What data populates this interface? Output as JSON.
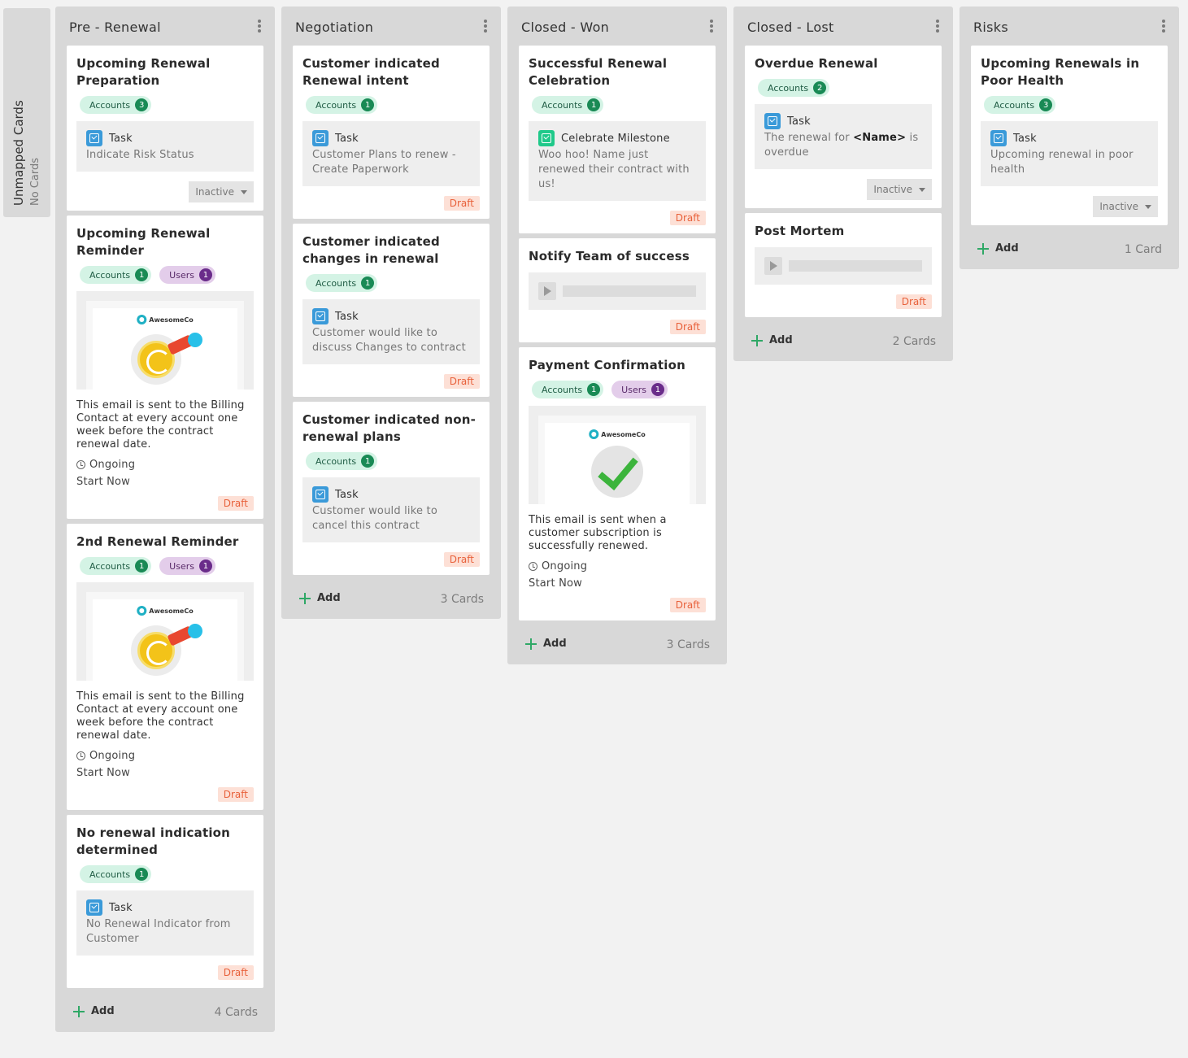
{
  "unmapped": {
    "title": "Unmapped Cards",
    "subtitle": "No Cards"
  },
  "columns": [
    {
      "title": "Pre - Renewal",
      "add_label": "Add",
      "count": "4 Cards",
      "cards": [
        {
          "title": "Upcoming Renewal Preparation",
          "tags": [
            {
              "label": "Accounts",
              "count": "3"
            }
          ],
          "task": {
            "label": "Task",
            "body": "Indicate Risk Status"
          },
          "status": "Inactive"
        },
        {
          "title": "Upcoming Renewal Reminder",
          "tags": [
            {
              "label": "Accounts",
              "count": "1"
            },
            {
              "label": "Users",
              "count": "1"
            }
          ],
          "preview": {
            "logo": "AwesomeCo"
          },
          "desc": "This email is sent to the Billing Contact at every account one week before the contract renewal date.",
          "schedule": "Ongoing",
          "start": "Start Now",
          "status": "Draft"
        },
        {
          "title": "2nd Renewal Reminder",
          "tags": [
            {
              "label": "Accounts",
              "count": "1"
            },
            {
              "label": "Users",
              "count": "1"
            }
          ],
          "preview": {
            "logo": "AwesomeCo"
          },
          "desc": "This email is sent to the Billing Contact at every account one week before the contract renewal date.",
          "schedule": "Ongoing",
          "start": "Start Now",
          "status": "Draft"
        },
        {
          "title": "No renewal indication determined",
          "tags": [
            {
              "label": "Accounts",
              "count": "1"
            }
          ],
          "task": {
            "label": "Task",
            "body": "No Renewal Indicator from Customer"
          },
          "status": "Draft"
        }
      ]
    },
    {
      "title": "Negotiation",
      "add_label": "Add",
      "count": "3 Cards",
      "cards": [
        {
          "title": "Customer indicated Renewal intent",
          "tags": [
            {
              "label": "Accounts",
              "count": "1"
            }
          ],
          "task": {
            "label": "Task",
            "body": "Customer Plans to renew - Create Paperwork"
          },
          "status": "Draft"
        },
        {
          "title": "Customer indicated changes in renewal",
          "tags": [
            {
              "label": "Accounts",
              "count": "1"
            }
          ],
          "task": {
            "label": "Task",
            "body": "Customer would like to discuss Changes to contract"
          },
          "status": "Draft"
        },
        {
          "title": "Customer indicated non-renewal plans",
          "tags": [
            {
              "label": "Accounts",
              "count": "1"
            }
          ],
          "task": {
            "label": "Task",
            "body": "Customer would like to cancel this contract"
          },
          "status": "Draft"
        }
      ]
    },
    {
      "title": "Closed - Won",
      "add_label": "Add",
      "count": "3 Cards",
      "cards": [
        {
          "title": "Successful Renewal Celebration",
          "tags": [
            {
              "label": "Accounts",
              "count": "1"
            }
          ],
          "milestone": {
            "label": "Celebrate Milestone",
            "body": "Woo hoo! Name just renewed their contract with us!"
          },
          "status": "Draft"
        },
        {
          "title": "Notify Team of success",
          "video": true,
          "status": "Draft"
        },
        {
          "title": "Payment Confirmation",
          "tags": [
            {
              "label": "Accounts",
              "count": "1"
            },
            {
              "label": "Users",
              "count": "1"
            }
          ],
          "preview": {
            "logo": "AwesomeCo"
          },
          "desc": "This email is sent when a customer subscription is successfully renewed.",
          "schedule": "Ongoing",
          "start": "Start Now",
          "status": "Draft"
        }
      ]
    },
    {
      "title": "Closed - Lost",
      "add_label": "Add",
      "count": "2 Cards",
      "cards": [
        {
          "title": "Overdue Renewal",
          "tags": [
            {
              "label": "Accounts",
              "count": "2"
            }
          ],
          "task": {
            "label": "Task",
            "body_pre": "The renewal for ",
            "body_bold": "<Name>",
            "body_post": " is overdue"
          },
          "status": "Inactive"
        },
        {
          "title": "Post Mortem",
          "video": true,
          "status": "Draft"
        }
      ]
    },
    {
      "title": "Risks",
      "add_label": "Add",
      "count": "1 Card",
      "cards": [
        {
          "title": "Upcoming Renewals in Poor Health",
          "tags": [
            {
              "label": "Accounts",
              "count": "3"
            }
          ],
          "task": {
            "label": "Task",
            "body": "Upcoming renewal in poor health"
          },
          "status": "Inactive"
        }
      ]
    }
  ],
  "colors": {
    "accounts_tag": "#d4f3e5",
    "users_tag": "#e3cdea",
    "draft": "#e8613b",
    "add_plus": "#2fa866",
    "task_icon": "#3a9ad9"
  }
}
